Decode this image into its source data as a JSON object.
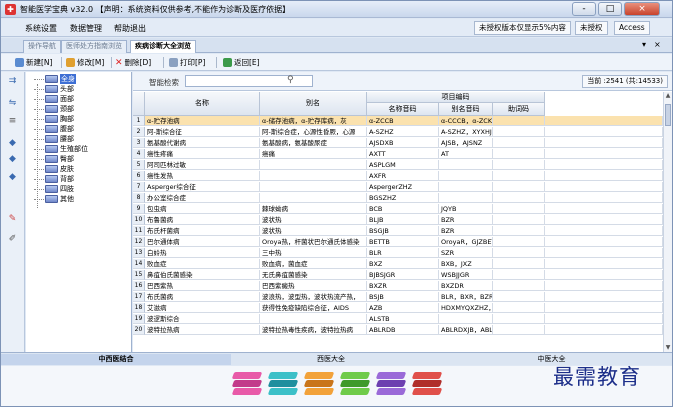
{
  "window": {
    "title": "智能医学宝典 v32.0 【声明：系统资料仅供参考,不能作为诊断及医疗依据】",
    "controls": [
      "-",
      "□",
      "×"
    ]
  },
  "menu": {
    "items": [
      "系统设置",
      "数据管理",
      "帮助退出"
    ],
    "right_buttons": [
      "未授权版本仅显示5%内容",
      "未授权",
      "Access"
    ]
  },
  "tabs": {
    "items": [
      {
        "label": "操作导航"
      },
      {
        "label": "医师处方指南浏览"
      },
      {
        "label": "疾病诊断大全浏览"
      }
    ],
    "controls": [
      "▾",
      "×"
    ]
  },
  "toolbar": {
    "new": "新建[N]",
    "edit": "修改[M]",
    "delete": "删除[D]",
    "print": "打印[P]",
    "back": "返回[E]"
  },
  "tree": {
    "items": [
      "全身",
      "头部",
      "面部",
      "颈部",
      "胸部",
      "腹部",
      "腰部",
      "生殖部位",
      "臀部",
      "皮肤",
      "背部",
      "四肢",
      "其他"
    ]
  },
  "search": {
    "label": "智能检索",
    "count": "当前 :2541 (共:14533)"
  },
  "grid": {
    "headers": {
      "name": "名称",
      "alias": "别名",
      "code_group": "项目编码",
      "name_code": "名称音码",
      "alias_code": "别名音码",
      "helper_code": "助词码"
    },
    "rows": [
      [
        "1",
        "α-贮存池病",
        "α-储存池病，α-贮存库病，灰",
        "α-ZCCB",
        "α-CCCB，α-ZCKB"
      ],
      [
        "2",
        "阿-斯综合征",
        "阿-斯综合症，心源性昏厥，心源",
        "A-SZHZ",
        "A-SZHZ，XYXHJ，X"
      ],
      [
        "3",
        "氨基酸代谢病",
        "氨基酸病，氨基酸尿症",
        "AJSDXB",
        "AJSB，AJSNZ"
      ],
      [
        "4",
        "癌性疼痛",
        "癌痛",
        "AXTT",
        "AT"
      ],
      [
        "5",
        "阿司匹林过敏",
        "",
        "ASPLGM",
        ""
      ],
      [
        "6",
        "癌性发热",
        "",
        "AXFR",
        ""
      ],
      [
        "7",
        "Asperger综合征",
        "",
        "AspergerZHZ",
        ""
      ],
      [
        "8",
        "办公室综合症",
        "",
        "BGSZHZ",
        ""
      ],
      [
        "9",
        "包虫病",
        "棘球蚴病",
        "BCB",
        "JQYB"
      ],
      [
        "10",
        "布鲁菌病",
        "波状热",
        "BLJB",
        "BZR"
      ],
      [
        "11",
        "布氏杆菌病",
        "波状热",
        "BSGJB",
        "BZR"
      ],
      [
        "12",
        "巴尔通体病",
        "Oroya热，杆菌状巴尔通氏体感染",
        "BETTB",
        "OroyaR，GJZBETST"
      ],
      [
        "13",
        "白蛉热",
        "三中热",
        "BLR",
        "SZR"
      ],
      [
        "14",
        "败血症",
        "败血病，菌血症",
        "BXZ",
        "BXB，JXZ"
      ],
      [
        "15",
        "鼻疽伯氏菌感染",
        "无氏鼻疽菌感染",
        "BJBSJGR",
        "WSBJJGR"
      ],
      [
        "16",
        "巴西紫热",
        "巴西紫癜热",
        "BXZR",
        "BXZDR"
      ],
      [
        "17",
        "布氏菌病",
        "波浪热，波型热，波状热流产热，",
        "BSJB",
        "BLR，BXR，BZRLCR"
      ],
      [
        "18",
        "艾滋病",
        "获得性免疫缺陷综合征，AIDS",
        "AZB",
        "HDXMYQXZHZ，AIDS"
      ],
      [
        "19",
        "波逻斯综合",
        "",
        "ALSTB",
        ""
      ],
      [
        "20",
        "波特拉热病",
        "波特拉热毒性疾病，波特拉热病",
        "ABLRDB",
        "ABLRDXJB，ABLCXB"
      ]
    ]
  },
  "bottom_tabs": [
    "中西医结合",
    "西医大全",
    "中医大全"
  ],
  "brand": "最需教育",
  "colors": {
    "selected_row": "#fbe2ae",
    "selected_tree": "#3e6fd4",
    "chrome": "#dfe8f4"
  }
}
